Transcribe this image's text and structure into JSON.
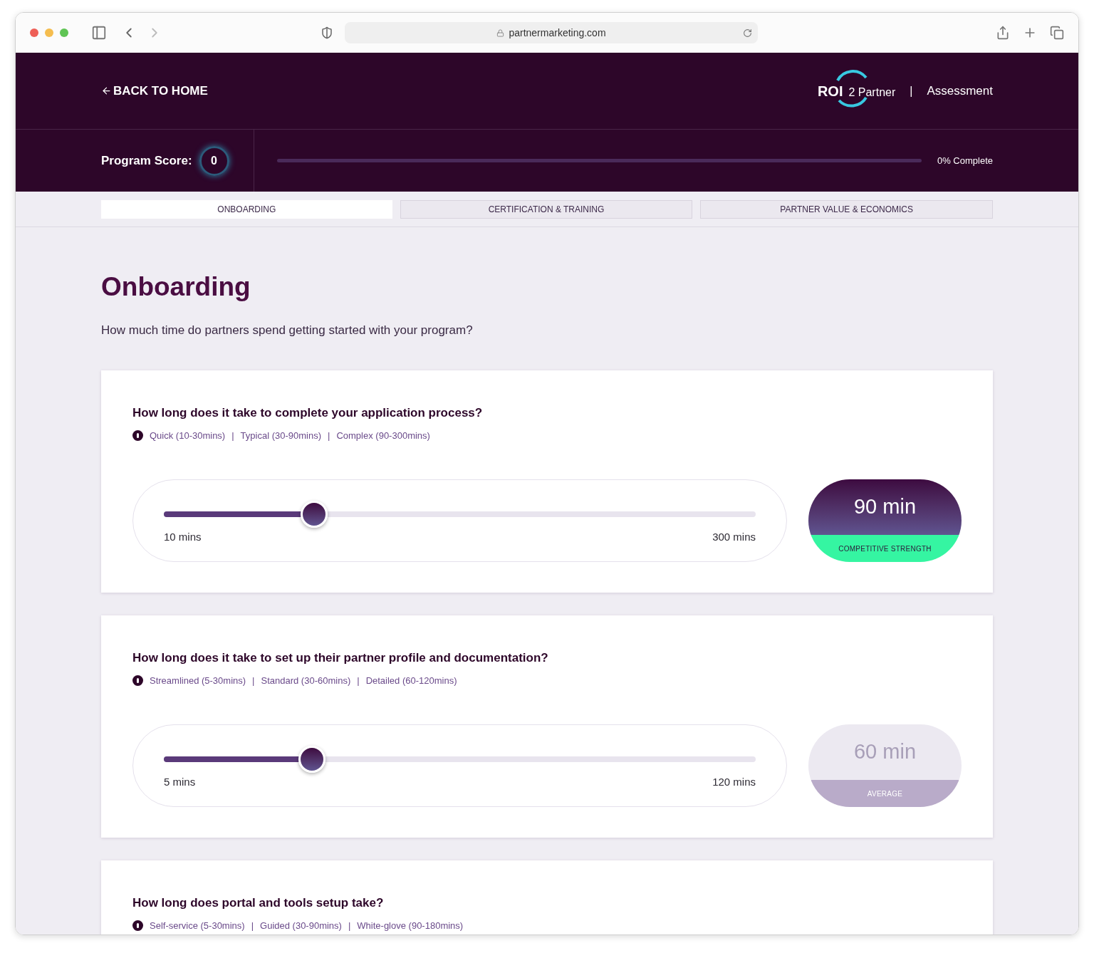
{
  "browser": {
    "url": "partnermarketing.com"
  },
  "header": {
    "back_link": "BACK TO HOME",
    "logo_main": "ROI",
    "logo_sub": "2 Partner",
    "separator": "|",
    "section": "Assessment"
  },
  "score": {
    "label": "Program Score:",
    "value": "0"
  },
  "progress": {
    "level": 0,
    "reading": "0% Complete"
  },
  "tabs": [
    {
      "label": "ONBOARDING",
      "selected": true
    },
    {
      "label": "CERTIFICATION & TRAINING",
      "selected": false
    },
    {
      "label": "PARTNER VALUE & ECONOMICS",
      "selected": false
    }
  ],
  "page": {
    "title": "Onboarding",
    "subtitle": "How much time do partners spend getting started with your program?"
  },
  "questions": [
    {
      "question": "How long does it take to complete your application process?",
      "hints": [
        "Quick (10-30mins)",
        "Typical (30-90mins)",
        "Complex (90-300mins)"
      ],
      "separator": "|",
      "slider": {
        "level": 0.254,
        "min_label": "10 mins",
        "max_label": "300 mins"
      },
      "result": {
        "kind": "strength",
        "value": "90 min",
        "label": "COMPETITIVE STRENGTH"
      }
    },
    {
      "question": "How long does it take to set up their partner profile and documentation?",
      "hints": [
        "Streamlined (5-30mins)",
        "Standard (30-60mins)",
        "Detailed (60-120mins)"
      ],
      "separator": "|",
      "slider": {
        "level": 0.25,
        "min_label": "5 mins",
        "max_label": "120 mins"
      },
      "result": {
        "kind": "average",
        "value": "60 min",
        "label": "AVERAGE"
      }
    },
    {
      "question": "How long does portal and tools setup take?",
      "hints": [
        "Self-service (5-30mins)",
        "Guided (30-90mins)",
        "White-glove (90-180mins)"
      ],
      "separator": "|"
    }
  ]
}
